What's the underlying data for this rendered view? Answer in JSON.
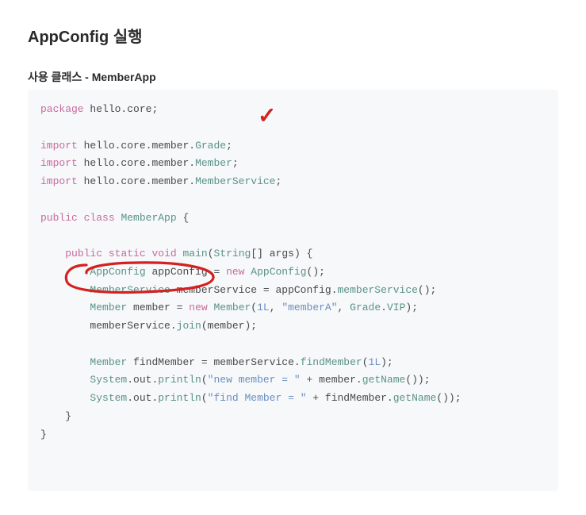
{
  "title": "AppConfig 실행",
  "subtitle": "사용 클래스 - MemberApp",
  "annotations": {
    "checkmark": "✓",
    "circle_target": "AppConfig appConfig"
  },
  "code": {
    "tokens": {
      "package": "package",
      "import": "import",
      "public": "public",
      "class": "class",
      "static": "static",
      "void": "void",
      "new": "new",
      "hello_core": "hello.core",
      "hello_core_member": "hello.core.member",
      "Grade": "Grade",
      "Member": "Member",
      "MemberService": "MemberService",
      "MemberApp": "MemberApp",
      "AppConfig": "AppConfig",
      "String": "String",
      "main": "main",
      "args": "args",
      "appConfig_var": "appConfig",
      "memberService_var": "memberService",
      "memberService_call": "memberService",
      "member_var": "member",
      "findMember_var": "findMember",
      "one_L": "1L",
      "memberA": "\"memberA\"",
      "VIP": "VIP",
      "join": "join",
      "findMember_call": "findMember",
      "System": "System",
      "out": "out",
      "println": "println",
      "new_member_eq": "\"new member = \"",
      "find_member_eq": "\"find Member = \"",
      "getName": "getName"
    }
  }
}
